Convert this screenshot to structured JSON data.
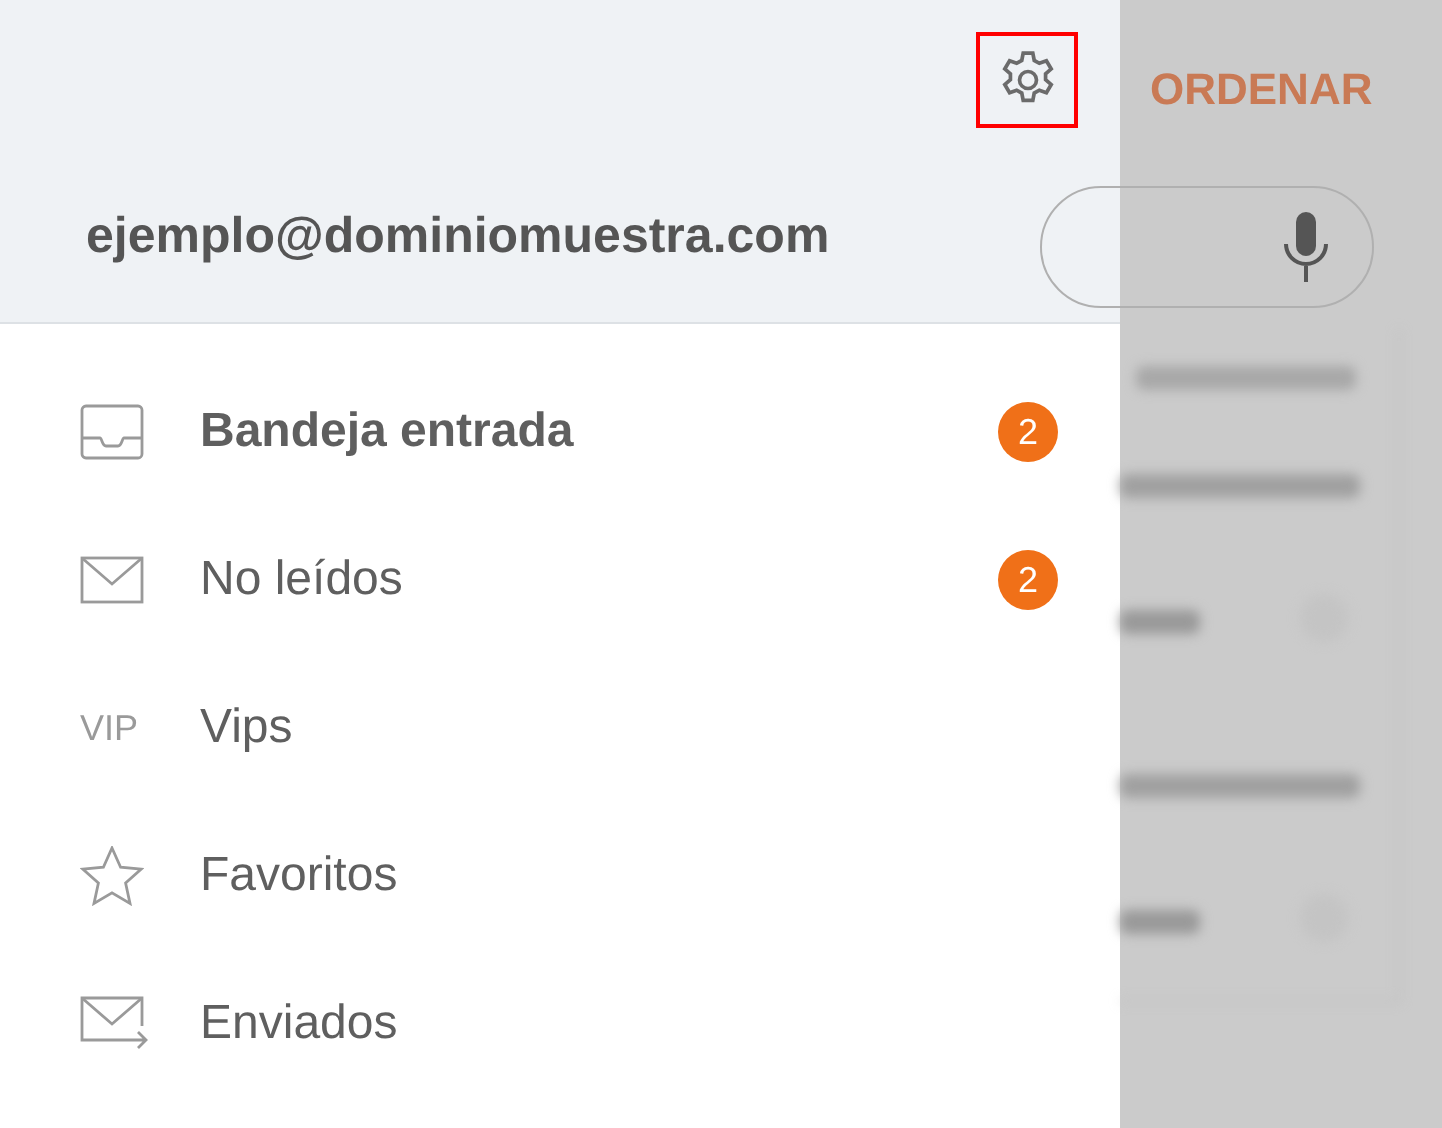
{
  "header": {
    "account": "ejemplo@dominiomuestra.com",
    "settings_highlighted": true
  },
  "folders": [
    {
      "kind": "inbox",
      "label": "Bandeja entrada",
      "selected": true,
      "count": "2"
    },
    {
      "kind": "unread",
      "label": "No leídos",
      "selected": false,
      "count": "2"
    },
    {
      "kind": "vip",
      "icon_text": "VIP",
      "label": "Vips",
      "selected": false
    },
    {
      "kind": "star",
      "label": "Favoritos",
      "selected": false
    },
    {
      "kind": "sent",
      "label": "Enviados",
      "selected": false
    }
  ],
  "background": {
    "sort_button": "ORDENAR"
  }
}
